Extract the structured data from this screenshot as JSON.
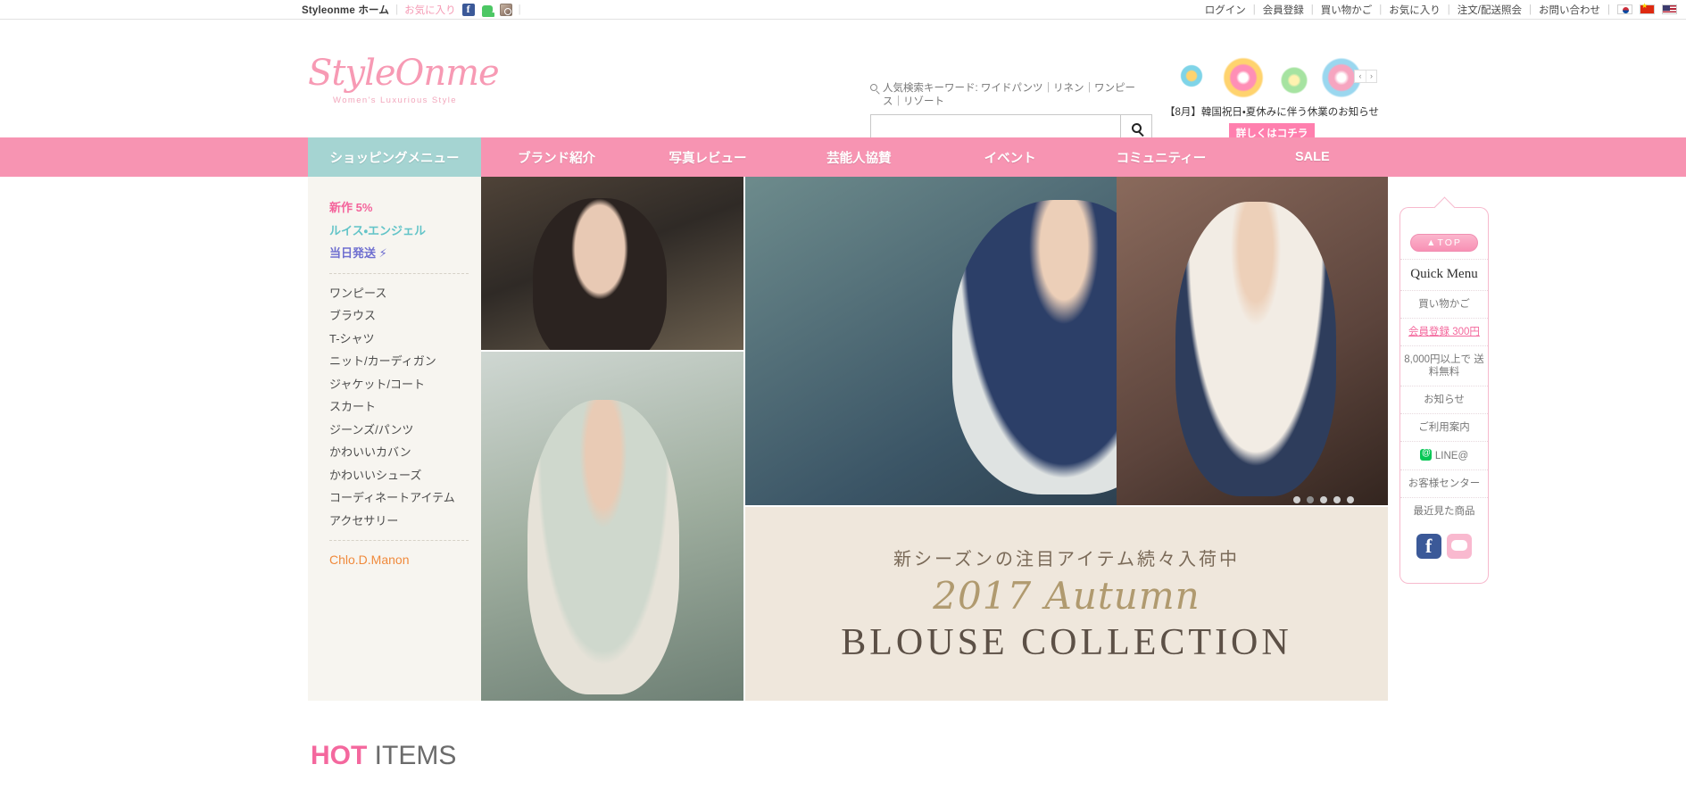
{
  "utilbar": {
    "home": "Styleonme ホーム",
    "favorites": "お気に入り",
    "social": [
      {
        "name": "facebook-icon",
        "label": "Facebook"
      },
      {
        "name": "line-icon",
        "label": "LINE"
      },
      {
        "name": "instagram-icon",
        "label": "Instagram"
      }
    ],
    "links": [
      "ログイン",
      "会員登録",
      "買い物かご",
      "お気に入り",
      "注文/配送照会",
      "お問い合わせ"
    ],
    "flags": [
      "한국어",
      "中文",
      "English"
    ]
  },
  "header": {
    "logo_text": "StyleOnme",
    "logo_tagline": "Women's Luxurious Style",
    "search": {
      "keyword_label": "人気検索キーワード:",
      "keywords": "ワイドパンツ｜リネン｜ワンピース｜リゾート",
      "keyword_full": "人気検索キーワード: ワイドパンツ｜リネン｜ワンピース｜リゾート",
      "value": "",
      "placeholder": "",
      "button_icon": "search-icon"
    },
    "promo": {
      "notice": "【8月】韓国祝日・夏休みに伴う休業のお知らせ",
      "button": "詳しくはコチラ",
      "prev": "‹",
      "next": "›"
    }
  },
  "nav": {
    "shopping_menu": "ショッピングメニュー",
    "items": [
      "ブランド紹介",
      "写真レビュー",
      "芸能人協賛",
      "イベント",
      "コミュニティー",
      "SALE"
    ],
    "bg_color": "#f794b2",
    "shop_color": "#a5d4d2"
  },
  "sidebar": {
    "highlight": [
      {
        "label": "新作 5%",
        "style": "pink"
      },
      {
        "label": "ルイス・エンジェル",
        "style": "teal"
      },
      {
        "label": "当日発送 ⚡",
        "style": "purple"
      }
    ],
    "categories": [
      "ワンピース",
      "ブラウス",
      "T-シャツ",
      "ニット/カーディガン",
      "ジャケット/コート",
      "スカート",
      "ジーンズ/パンツ",
      "かわいいカバン",
      "かわいいシューズ",
      "コーディネートアイテム",
      "アクセサリー"
    ],
    "brand": "Chlo.D.Manon"
  },
  "visual": {
    "banner_line1": "新シーズンの注目アイテム続々入荷中",
    "banner_line2": "2017 Autumn",
    "banner_line3": "BLOUSE COLLECTION",
    "dots": 5,
    "active_dot": 1
  },
  "quick_menu": {
    "top_button": "▲TOP",
    "title": "Quick Menu",
    "items": [
      {
        "label": "買い物かご",
        "style": "plain"
      },
      {
        "label": "会員登録 300円",
        "style": "pinkline"
      },
      {
        "label": "8,000円以上で 送料無料",
        "style": "plain"
      },
      {
        "label": "お知らせ",
        "style": "plain"
      },
      {
        "label": "ご利用案内",
        "style": "plain"
      },
      {
        "label": "LINE@",
        "style": "line"
      },
      {
        "label": "お客様センター",
        "style": "plain"
      },
      {
        "label": "最近見た商品",
        "style": "plain"
      }
    ],
    "social": [
      {
        "name": "facebook-icon"
      },
      {
        "name": "line-icon"
      }
    ]
  },
  "hot_items": {
    "highlight": "HOT",
    "rest": " ITEMS"
  }
}
